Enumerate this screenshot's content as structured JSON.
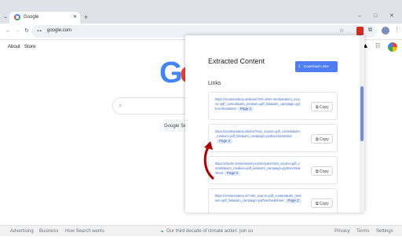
{
  "browser": {
    "tab_title": "Google",
    "new_tab": "+",
    "url": "google.com",
    "window_controls": [
      "–",
      "□",
      "✕"
    ]
  },
  "google": {
    "top_links": [
      "About",
      "Store"
    ],
    "logo_letters": [
      "G",
      "o"
    ],
    "search_button": "Google Search",
    "footer": {
      "left": [
        "Advertising",
        "Business",
        "How Search works"
      ],
      "center": "Our third decade of climate action: join us",
      "right": [
        "Privacy",
        "Terms",
        "Settings"
      ]
    }
  },
  "popup": {
    "title": "Extracted Content",
    "download_label": "Download Links",
    "links_heading": "Links",
    "copy_label": "Copy",
    "links": [
      {
        "url": "https://zenstoreatery.io/about/?ref=other-medium&utm_source=pdf_content&utm_medium=pdf_link&utm_campaign=pythoncheatsheet",
        "page": "Page 1"
      },
      {
        "url": "https://zenstoreatery.io/jobs/?utm_source=pdf_content&utm_medium=pdf_link&utm_campaign=pythoncheatsheet",
        "page": "Page 2"
      },
      {
        "url": "https://ebook.zenstoreatery.io/principles?utm_source=pdf_content&utm_medium=pdf_link&utm_campaign=pythoncheatsheet",
        "page": "Page 2"
      },
      {
        "url": "https://zenstoreatery.io/?utm_source=pdf_content&utm_medium=pdf_link&utm_campaign=pythoncheatsheet",
        "page": "Page 2"
      }
    ]
  },
  "colors": {
    "google_blue": "#4285f4",
    "google_red": "#ea4335",
    "accent": "#4e7ef1",
    "arrow": "#b00000"
  }
}
